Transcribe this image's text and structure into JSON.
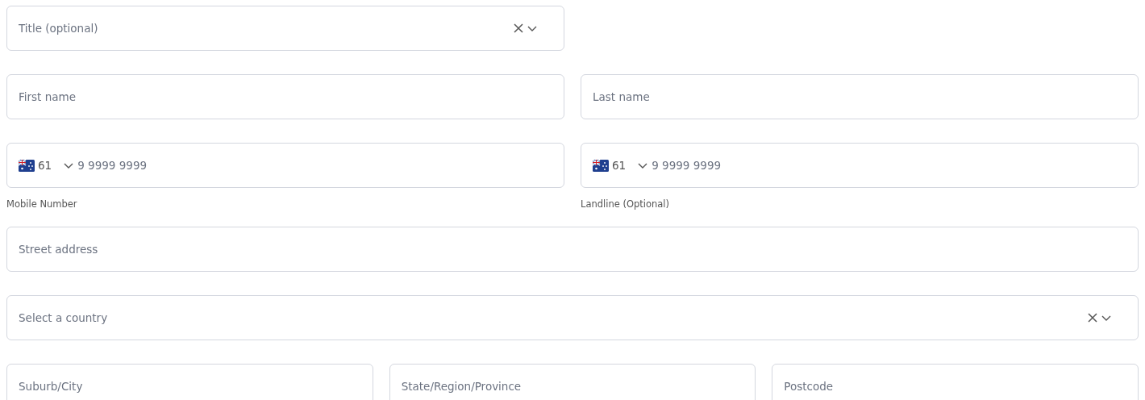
{
  "rows": [
    {
      "fields": [
        {
          "kind": "select",
          "placeholder": "Title (optional)"
        }
      ]
    },
    {
      "fields": [
        {
          "kind": "text",
          "placeholder": "First name"
        },
        {
          "kind": "text",
          "placeholder": "Last name"
        }
      ]
    },
    {
      "fields": [
        {
          "kind": "phone",
          "code": "61",
          "placeholder": "9 9999 9999",
          "label": "Mobile Number"
        },
        {
          "kind": "phone",
          "code": "61",
          "placeholder": "9 9999 9999",
          "label": "Landline (Optional)"
        }
      ]
    },
    {
      "fields": [
        {
          "kind": "text",
          "placeholder": "Street address"
        }
      ]
    },
    {
      "fields": [
        {
          "kind": "select",
          "placeholder": "Select a country"
        }
      ]
    },
    {
      "fields": [
        {
          "kind": "text",
          "placeholder": "Suburb/City"
        },
        {
          "kind": "text",
          "placeholder": "State/Region/Province"
        },
        {
          "kind": "text",
          "placeholder": "Postcode"
        }
      ]
    }
  ]
}
